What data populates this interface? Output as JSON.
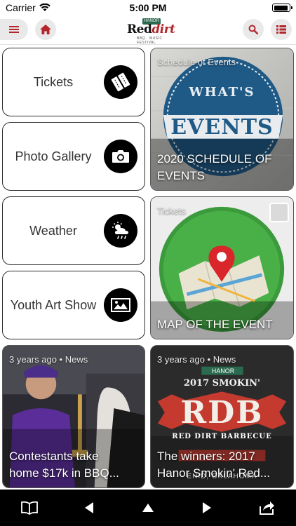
{
  "status": {
    "carrier": "Carrier",
    "time": "5:00 PM"
  },
  "header": {
    "logo": {
      "badge": "HANOR",
      "text_a": "Red",
      "text_b": "dirt",
      "subtitle": "BBQ · MUSIC FESTIVAL"
    },
    "colors": {
      "button_bg": "#e9e9e9",
      "icon_red": "#b3262b"
    }
  },
  "tiles": [
    {
      "label": "Tickets",
      "icon": "ticket-icon"
    },
    {
      "label": "Photo Gallery",
      "icon": "camera-icon"
    },
    {
      "label": "Weather",
      "icon": "weather-icon"
    },
    {
      "label": "Youth Art Show",
      "icon": "image-icon"
    }
  ],
  "cards": {
    "events": {
      "tag": "Schedule of Events",
      "title": "2020 SCHEDULE OF EVENTS",
      "art_top": "WHAT'S",
      "art_main": "EVENTS"
    },
    "map": {
      "tag": "Tickets",
      "title": "MAP OF THE EVENT"
    },
    "news1": {
      "tag": "3 years ago • News",
      "title": "Contestants take\nhome $17k in BBQ..."
    },
    "news2": {
      "tag": "3 years ago • News",
      "title": "The winners: 2017\nHanor Smokin' Red...",
      "art_badge": "HANOR",
      "art_year": "2017 SMOKIN'",
      "art_big": "RDB",
      "art_sub": "RED DIRT BARBECUE",
      "art_loc": "ENID, OKLAHOMA"
    }
  },
  "toolbar": {
    "items": [
      "bookmarks-icon",
      "back-icon",
      "up-icon",
      "forward-icon",
      "share-icon"
    ]
  }
}
